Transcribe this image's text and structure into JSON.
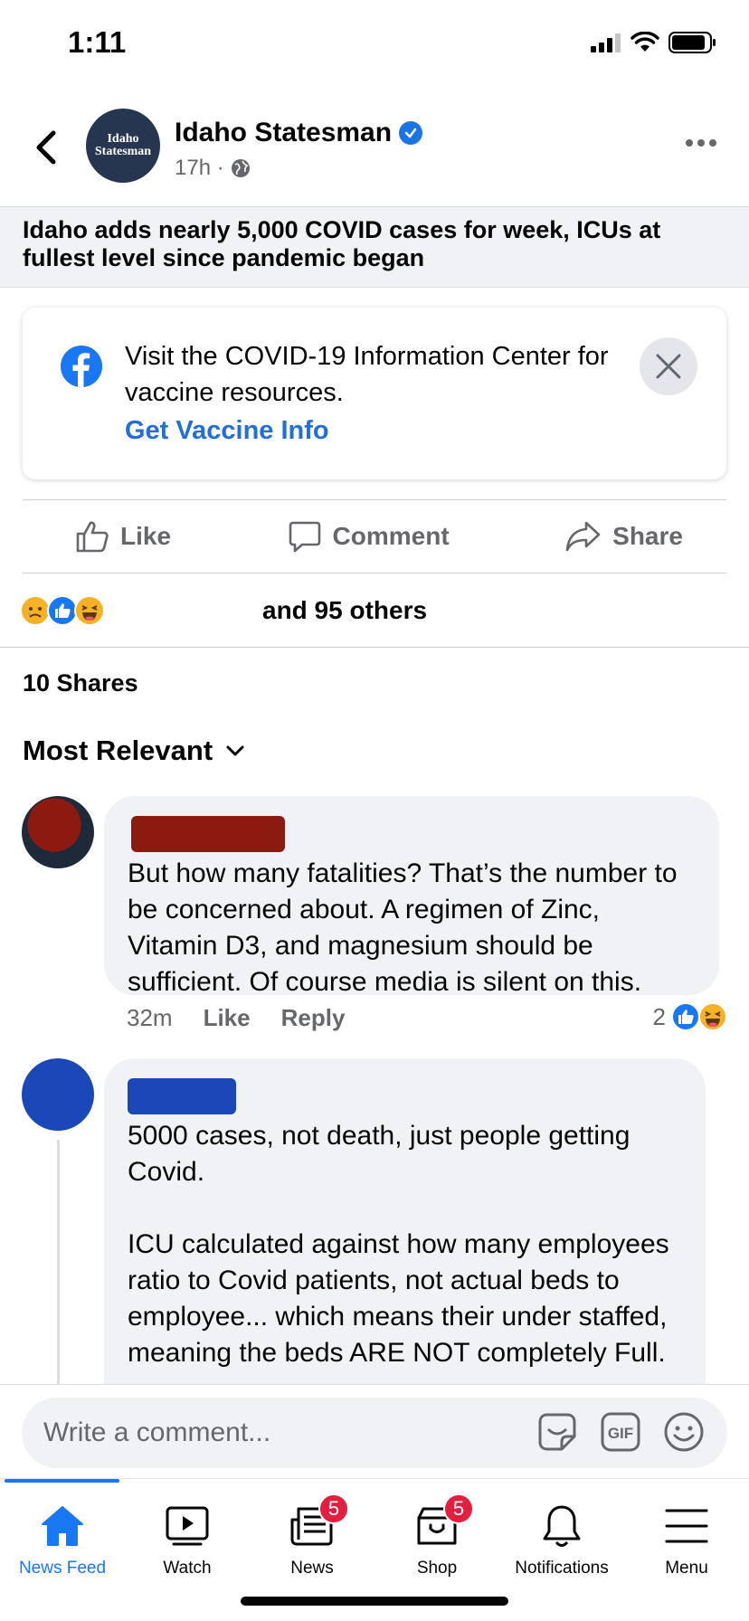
{
  "status_bar": {
    "time": "1:11"
  },
  "header": {
    "page_name": "Idaho Statesman",
    "avatar_line1": "Idaho",
    "avatar_line2": "Statesman",
    "post_time": "17h ·"
  },
  "post": {
    "headline": "Idaho adds nearly 5,000 COVID cases for week, ICUs at fullest level since pandemic began"
  },
  "info_card": {
    "text": "Visit the COVID-19 Information Center for vaccine resources.",
    "link": "Get Vaccine Info"
  },
  "actions": {
    "like": "Like",
    "comment": "Comment",
    "share": "Share"
  },
  "reactions": {
    "summary": "and 95 others",
    "shares": "10 Shares"
  },
  "comments_sort": {
    "label": "Most Relevant"
  },
  "comments": [
    {
      "text": "But how many fatalities?  That’s the number to be concerned about.  A regimen of Zinc, Vitamin D3, and magnesium should be sufficient.  Of course media is silent on this.",
      "time": "32m",
      "like": "Like",
      "reply": "Reply",
      "reaction_count": "2",
      "redact_color": "#8b1a10",
      "avatar_color": "#5a1e18"
    },
    {
      "text_p1": "5000 cases, not death, just people getting Covid.",
      "text_p2": "ICU calculated against how many employees ratio to Covid patients, not actual beds to employee... which means their under staffed, meaning the beds ARE NOT completely Full.",
      "redact_color": "#1a48b8",
      "avatar_color": "#1a48b8"
    }
  ],
  "composer": {
    "placeholder": "Write a comment..."
  },
  "tabbar": {
    "tabs": [
      {
        "label": "News Feed",
        "icon": "home-icon",
        "active": true
      },
      {
        "label": "Watch",
        "icon": "watch-icon"
      },
      {
        "label": "News",
        "icon": "news-icon",
        "badge": "5"
      },
      {
        "label": "Shop",
        "icon": "shop-icon",
        "badge": "5"
      },
      {
        "label": "Notifications",
        "icon": "bell-icon"
      },
      {
        "label": "Menu",
        "icon": "menu-icon"
      }
    ]
  },
  "colors": {
    "accent": "#1877f2",
    "link": "#216fdb",
    "secondary_text": "#65676b",
    "bubble_bg": "#f0f2f5",
    "badge": "#e41e3f"
  }
}
